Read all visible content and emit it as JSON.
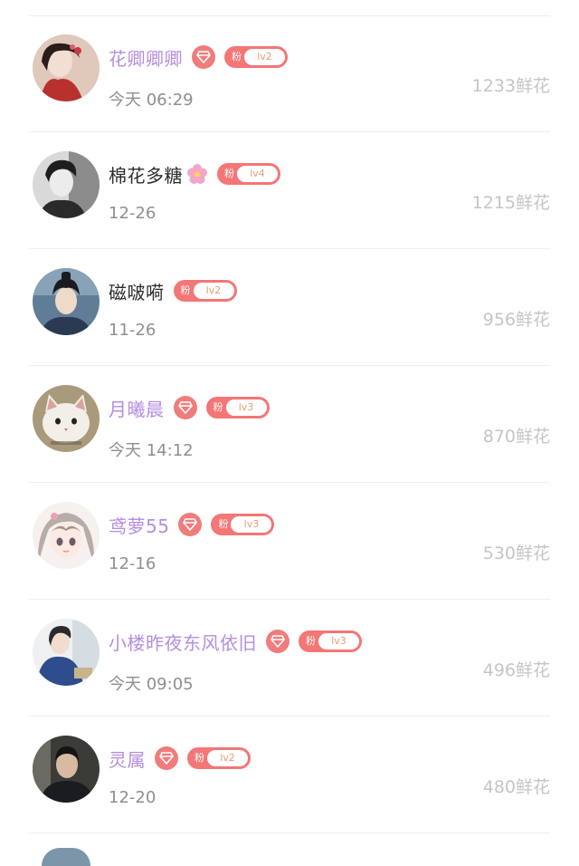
{
  "colors": {
    "vip_name": "#b58ee0",
    "plain_name": "#2b2b2b",
    "badge_red": "#f47676",
    "level_text": "#e89c74",
    "time_text": "#8f8f8f",
    "flower_count": "#c5c5c5"
  },
  "fan_badge_label": "粉",
  "rows": [
    {
      "name": "花卿卿卿",
      "vip": true,
      "level": "lv2",
      "time": "今天 06:29",
      "flowers": "1233鲜花",
      "avatar_icon": "girl-portrait-icon"
    },
    {
      "name": "棉花多糖",
      "vip": false,
      "emoji": "cherry-blossom-icon",
      "level": "lv4",
      "time": "12-26",
      "flowers": "1215鲜花",
      "avatar_icon": "man-bw-portrait-icon"
    },
    {
      "name": "磁啵嗬",
      "vip": false,
      "level": "lv2",
      "time": "11-26",
      "flowers": "956鲜花",
      "avatar_icon": "costume-man-portrait-icon"
    },
    {
      "name": "月曦晨",
      "vip": true,
      "level": "lv3",
      "time": "今天 14:12",
      "flowers": "870鲜花",
      "avatar_icon": "cat-portrait-icon"
    },
    {
      "name": "鸢萝55",
      "vip": true,
      "level": "lv3",
      "time": "12-16",
      "flowers": "530鲜花",
      "avatar_icon": "anime-girl-portrait-icon"
    },
    {
      "name": "小楼昨夜东风依旧",
      "vip": true,
      "level": "lv3",
      "time": "今天 09:05",
      "flowers": "496鲜花",
      "avatar_icon": "man-blue-shirt-portrait-icon"
    },
    {
      "name": "灵属",
      "vip": true,
      "level": "lv2",
      "time": "12-20",
      "flowers": "480鲜花",
      "avatar_icon": "man-dark-portrait-icon"
    }
  ]
}
